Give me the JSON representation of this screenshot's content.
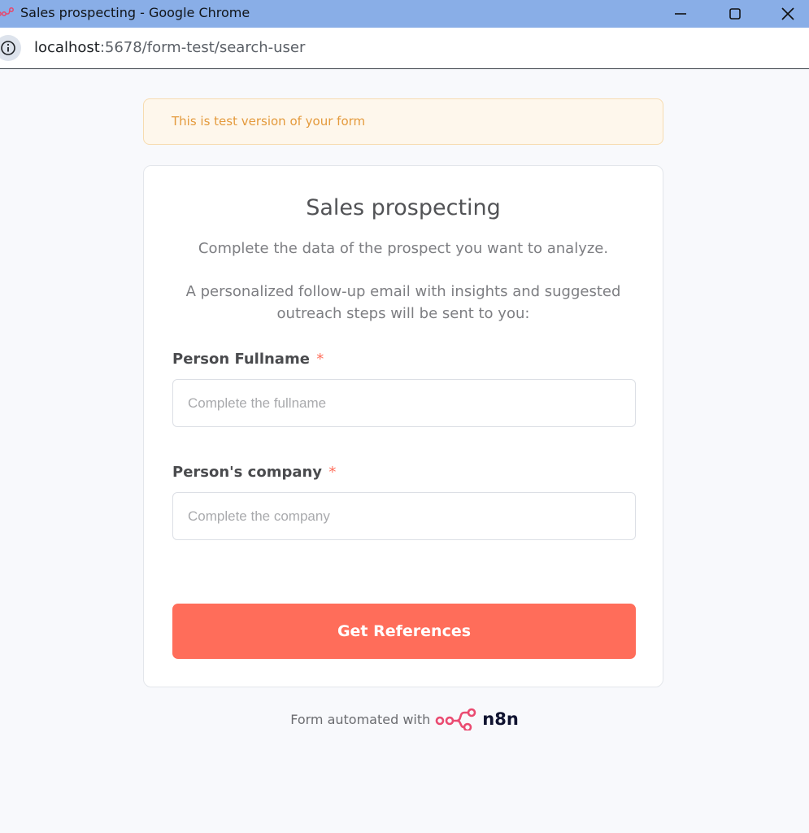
{
  "window": {
    "title": "Sales prospecting - Google Chrome"
  },
  "address_bar": {
    "host": "localhost",
    "path": ":5678/form-test/search-user"
  },
  "banner": {
    "text": "This is test version of your form"
  },
  "form": {
    "title": "Sales prospecting",
    "description_1": "Complete the data of the prospect you want to analyze.",
    "description_2": "A personalized follow-up email with insights and suggested outreach steps will be sent to you:",
    "fields": [
      {
        "label": "Person Fullname",
        "required_mark": "*",
        "placeholder": "Complete the fullname",
        "value": ""
      },
      {
        "label": "Person's company",
        "required_mark": "*",
        "placeholder": "Complete the company",
        "value": ""
      }
    ],
    "submit_label": "Get References"
  },
  "footer": {
    "text": "Form automated with",
    "logo_text": "n8n"
  },
  "colors": {
    "accent": "#ff6d5a",
    "banner_text": "#e49a3c",
    "titlebar": "#89aee7"
  },
  "icons": {
    "favicon": "n8n-logo-icon",
    "minimize": "minimize-icon",
    "maximize": "maximize-icon",
    "close": "close-icon",
    "site_info": "info-icon"
  }
}
